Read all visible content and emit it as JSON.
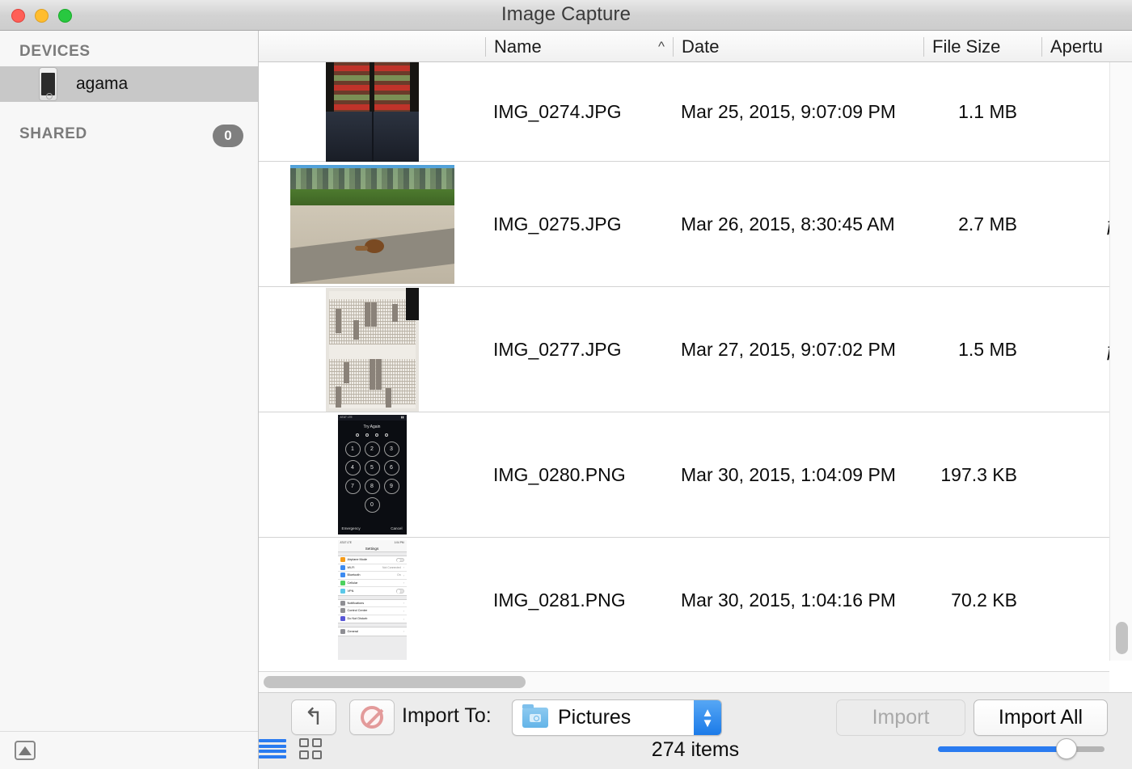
{
  "window": {
    "title": "Image Capture",
    "traffic_lights": [
      "close",
      "minimize",
      "zoom"
    ]
  },
  "sidebar": {
    "sections": [
      {
        "title": "DEVICES",
        "badge": null,
        "items": [
          {
            "label": "agama",
            "icon": "iphone-icon",
            "selected": true
          }
        ]
      },
      {
        "title": "SHARED",
        "badge": "0",
        "items": []
      }
    ],
    "eject_icon": "eject-icon"
  },
  "table": {
    "columns": [
      {
        "key": "thumbnail",
        "label": ""
      },
      {
        "key": "name",
        "label": "Name",
        "sort": "ascending",
        "sort_glyph": "^"
      },
      {
        "key": "date",
        "label": "Date"
      },
      {
        "key": "size",
        "label": "File Size"
      },
      {
        "key": "aperture",
        "label": "Apertu"
      }
    ],
    "rows": [
      {
        "thumbnail": "striped-socks-feet-photo",
        "name": "IMG_0274.JPG",
        "date": "Mar 25, 2015, 9:07:09 PM",
        "size": "1.1 MB",
        "aperture": ""
      },
      {
        "thumbnail": "snail-on-pavement-photo",
        "name": "IMG_0275.JPG",
        "date": "Mar 26, 2015, 8:30:45 AM",
        "size": "2.7 MB",
        "aperture": "ƒ"
      },
      {
        "thumbnail": "graph-paper-chart-photo",
        "name": "IMG_0277.JPG",
        "date": "Mar 27, 2015, 9:07:02 PM",
        "size": "1.5 MB",
        "aperture": "ƒ"
      },
      {
        "thumbnail": "iphone-passcode-lockscreen",
        "name": "IMG_0280.PNG",
        "date": "Mar 30, 2015, 1:04:09 PM",
        "size": "197.3 KB",
        "aperture": ""
      },
      {
        "thumbnail": "ios-settings-screenshot",
        "name": "IMG_0281.PNG",
        "date": "Mar 30, 2015, 1:04:16 PM",
        "size": "70.2 KB",
        "aperture": ""
      }
    ]
  },
  "thumbnails": {
    "lockscreen": {
      "carrier": "AT&T LTE",
      "prompt": "Try Again",
      "keys": [
        "1",
        "2",
        "3",
        "4",
        "5",
        "6",
        "7",
        "8",
        "9",
        "0"
      ],
      "emergency_label": "Emergency",
      "cancel_label": "Cancel"
    },
    "settings": {
      "time": "1:04 PM",
      "carrier": "AT&T LTE",
      "title": "Settings",
      "rows": [
        {
          "label": "Airplane Mode",
          "value": "",
          "control": "toggle",
          "color": "#f59c1a"
        },
        {
          "label": "Wi-Fi",
          "value": "Not Connected",
          "control": "chevron",
          "color": "#3c8af0"
        },
        {
          "label": "Bluetooth",
          "value": "On",
          "control": "chevron",
          "color": "#3c8af0"
        },
        {
          "label": "Cellular",
          "value": "",
          "control": "chevron",
          "color": "#4cd15f"
        },
        {
          "label": "VPN",
          "value": "",
          "control": "toggle",
          "color": "#5ac8e8"
        },
        {
          "label": "Notifications",
          "value": "",
          "control": "chevron",
          "color": "#8e8e93"
        },
        {
          "label": "Control Center",
          "value": "",
          "control": "chevron",
          "color": "#8e8e93"
        },
        {
          "label": "Do Not Disturb",
          "value": "",
          "control": "chevron",
          "color": "#5856d6"
        },
        {
          "label": "General",
          "value": "",
          "control": "chevron",
          "color": "#8e8e93"
        }
      ]
    }
  },
  "toolbar": {
    "rotate_icon": "rotate-left-icon",
    "delete_icon": "prohibit-delete-icon",
    "import_to_label": "Import To:",
    "destination": "Pictures",
    "destination_icon": "pictures-folder-icon",
    "import_label": "Import",
    "import_enabled": false,
    "import_all_label": "Import All",
    "view_list_icon": "list-view-icon",
    "view_grid_icon": "grid-view-icon",
    "active_view": "list",
    "item_count": "274 items",
    "zoom_slider_value": 77
  },
  "colors": {
    "accent": "#2a7bf0",
    "selection": "#c8c8c8",
    "stepper": "#1b7ae8",
    "close": "#ff5f57",
    "minimize": "#ffbd2e",
    "zoom": "#28c840"
  }
}
